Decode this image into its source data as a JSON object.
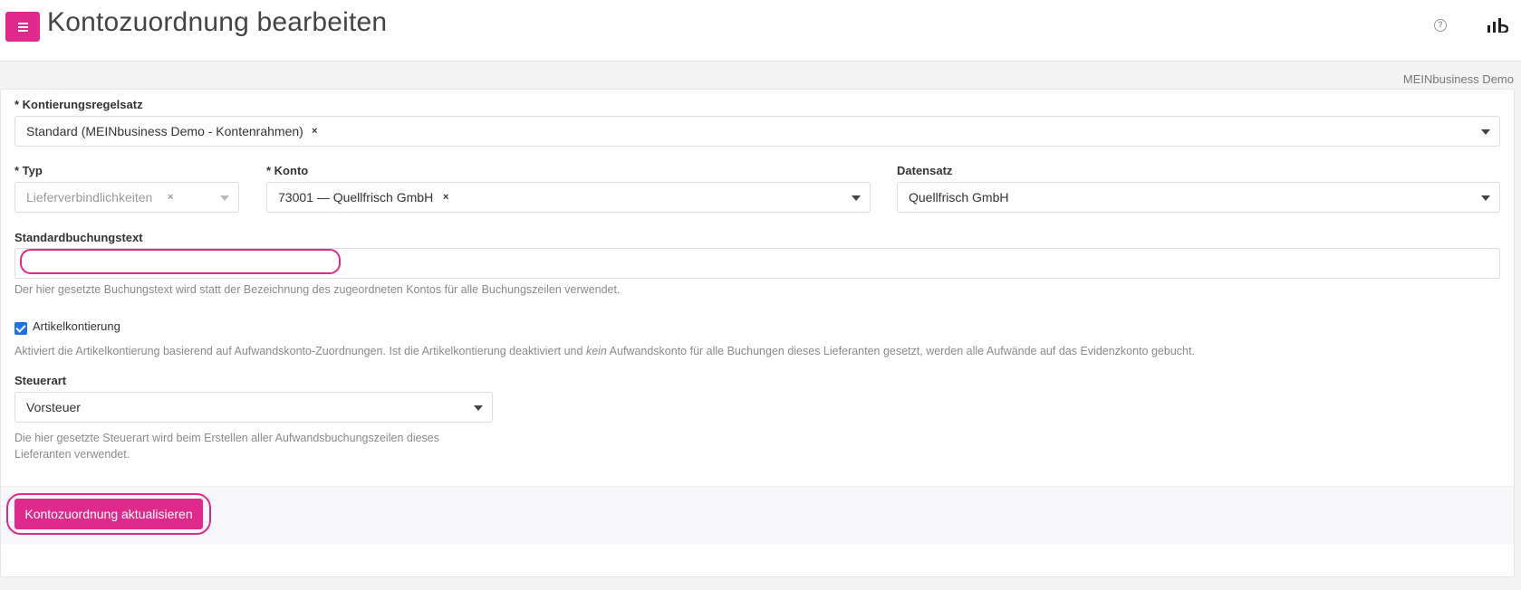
{
  "header": {
    "title": "Kontozuordnung bearbeiten",
    "help_glyph": "?",
    "icons": {
      "menu": "menu-icon",
      "help": "help-circle-icon",
      "brand": "bar-chart-logo-icon"
    },
    "accent": "#e0298c"
  },
  "tenant": "MEINbusiness Demo",
  "form": {
    "regelsatz": {
      "label": "* Kontierungsregelsatz",
      "value": "Standard (MEINbusiness Demo - Kontenrahmen)",
      "clear": "×"
    },
    "typ": {
      "label": "* Typ",
      "value": "Lieferverbindlichkeiten",
      "clear": "×"
    },
    "konto": {
      "label": "* Konto",
      "value": "73001 — Quellfrisch GmbH",
      "clear": "×"
    },
    "datensatz": {
      "label": "Datensatz",
      "value": "Quellfrisch GmbH"
    },
    "buchungstext": {
      "label": "Standardbuchungstext",
      "value": "",
      "help": "Der hier gesetzte Buchungstext wird statt der Bezeichnung des zugeordneten Kontos für alle Buchungszeilen verwendet."
    },
    "artikelkontierung": {
      "label": "Artikelkontierung",
      "checked": true,
      "help_before": "Aktiviert die Artikelkontierung basierend auf Aufwandskonto-Zuordnungen. Ist die Artikelkontierung deaktiviert und ",
      "help_em": "kein",
      "help_after": " Aufwandskonto für alle Buchungen dieses Lieferanten gesetzt, werden alle Aufwände auf das Evidenzkonto gebucht."
    },
    "steuerart": {
      "label": "Steuerart",
      "value": "Vorsteuer",
      "help_line1": "Die hier gesetzte Steuerart wird beim Erstellen aller Aufwandsbuchungszeilen dieses",
      "help_line2": "Lieferanten verwendet."
    }
  },
  "submit": {
    "label": "Kontozuordnung aktualisieren"
  }
}
